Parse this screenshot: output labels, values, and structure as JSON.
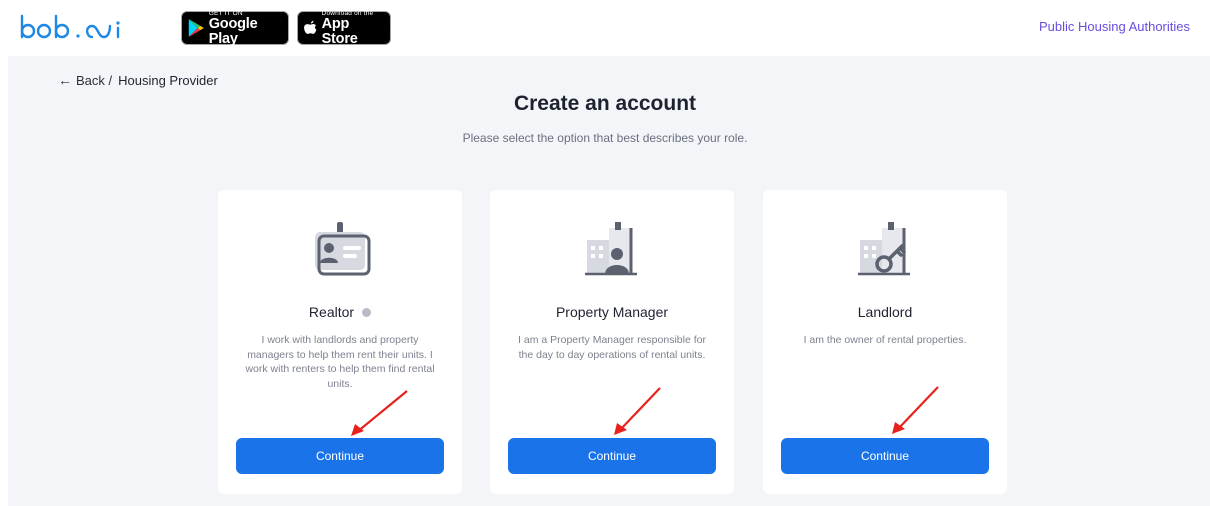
{
  "header": {
    "logo_alt": "bob.ai",
    "google_play": {
      "small": "GET IT ON",
      "big": "Google Play"
    },
    "app_store": {
      "small": "Download on the",
      "big": "App Store"
    },
    "nav_link": "Public Housing Authorities"
  },
  "breadcrumb": {
    "back_label": "Back /",
    "current": "Housing Provider"
  },
  "page": {
    "title": "Create an account",
    "subtitle": "Please select the option that best describes your role."
  },
  "cards": [
    {
      "name": "Realtor",
      "icon": "id-card-icon",
      "description": "I work with landlords and property managers to help them rent their units. I work with renters to help them find rental units.",
      "button": "Continue"
    },
    {
      "name": "Property Manager",
      "icon": "building-person-icon",
      "description": "I am a Property Manager responsible for the day to day operations of rental units.",
      "button": "Continue"
    },
    {
      "name": "Landlord",
      "icon": "building-key-icon",
      "description": "I am the owner of rental properties.",
      "button": "Continue"
    }
  ],
  "colors": {
    "primary": "#1a73e8",
    "link": "#6b4ce0",
    "panel_bg": "#f4f5f8",
    "annotation_arrow": "#e8211d",
    "logo": "#1e88e5"
  }
}
